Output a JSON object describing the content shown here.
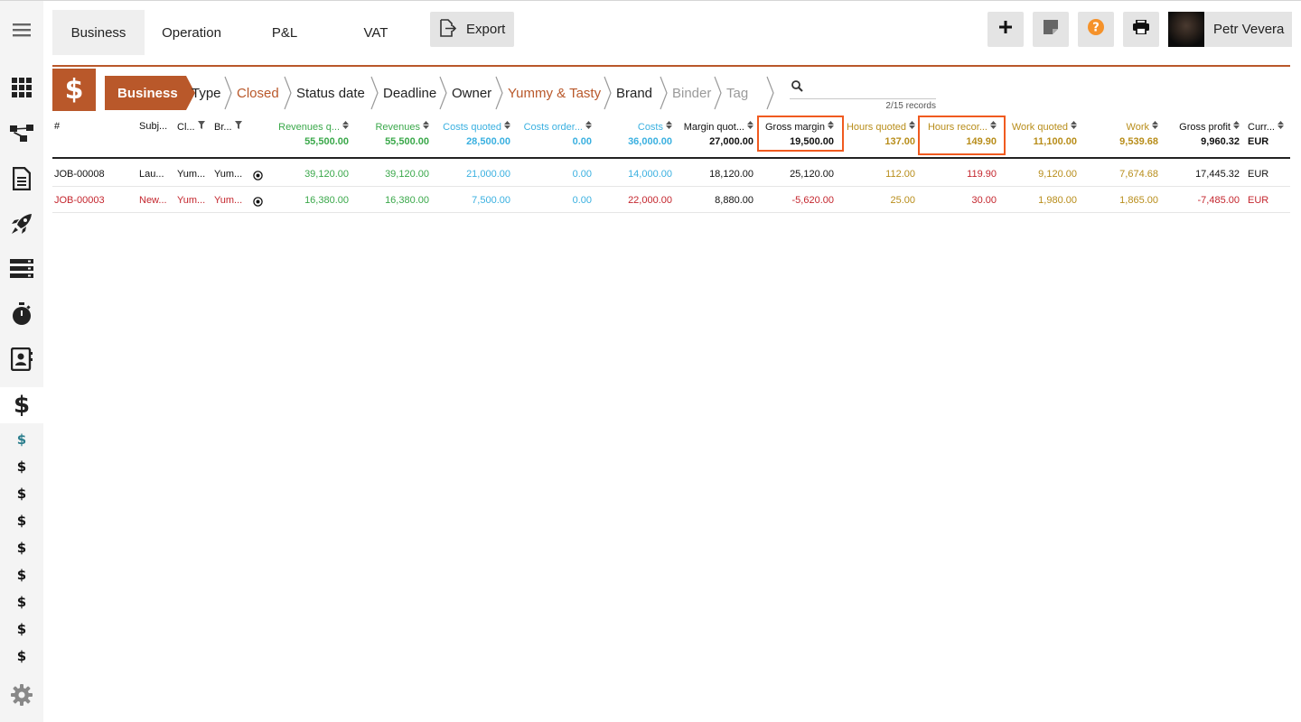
{
  "topbar": {
    "tabs": [
      "Business",
      "Operation",
      "P&L",
      "VAT"
    ],
    "active_tab": "Business",
    "export_label": "Export",
    "user_name": "Petr Vevera",
    "help_color": "#f5922a"
  },
  "breadcrumbs": [
    {
      "label": "Business",
      "state": "active"
    },
    {
      "label": "Type",
      "state": "normal"
    },
    {
      "label": "Closed",
      "state": "selected"
    },
    {
      "label": "Status date",
      "state": "normal"
    },
    {
      "label": "Deadline",
      "state": "normal"
    },
    {
      "label": "Owner",
      "state": "normal"
    },
    {
      "label": "Yummy & Tasty",
      "state": "selected"
    },
    {
      "label": "Brand",
      "state": "normal"
    },
    {
      "label": "Binder",
      "state": "disabled"
    },
    {
      "label": "Tag",
      "state": "disabled"
    }
  ],
  "search": {
    "placeholder": "",
    "records": "2/15 records"
  },
  "table": {
    "columns": [
      "#",
      "Subj...",
      "Cl...",
      "Br...",
      "Revenues q...",
      "Revenues",
      "Costs quoted",
      "Costs order...",
      "Costs",
      "Margin quot...",
      "Gross margin",
      "Hours quoted",
      "Hours recor...",
      "Work quoted",
      "Work",
      "Gross profit",
      "Curr..."
    ],
    "totals": {
      "revenues_quoted": "55,500.00",
      "revenues": "55,500.00",
      "costs_quoted": "28,500.00",
      "costs_ordered": "0.00",
      "costs": "36,000.00",
      "margin_quoted": "27,000.00",
      "gross_margin": "19,500.00",
      "hours_quoted": "137.00",
      "hours_recorded": "149.90",
      "work_quoted": "11,100.00",
      "work": "9,539.68",
      "gross_profit": "9,960.32",
      "currency": "EUR"
    },
    "rows": [
      {
        "id": "JOB-00008",
        "subject": "Lau...",
        "client": "Yum...",
        "brand": "Yum...",
        "revenues_quoted": "39,120.00",
        "revenues": "39,120.00",
        "costs_quoted": "21,000.00",
        "costs_ordered": "0.00",
        "costs": "14,000.00",
        "margin_quoted": "18,120.00",
        "gross_margin": "25,120.00",
        "hours_quoted": "112.00",
        "hours_recorded": "119.90",
        "work_quoted": "9,120.00",
        "work": "7,674.68",
        "gross_profit": "17,445.32",
        "currency": "EUR",
        "negative": false
      },
      {
        "id": "JOB-00003",
        "subject": "New...",
        "client": "Yum...",
        "brand": "Yum...",
        "revenues_quoted": "16,380.00",
        "revenues": "16,380.00",
        "costs_quoted": "7,500.00",
        "costs_ordered": "0.00",
        "costs": "22,000.00",
        "margin_quoted": "8,880.00",
        "gross_margin": "-5,620.00",
        "hours_quoted": "25.00",
        "hours_recorded": "30.00",
        "work_quoted": "1,980.00",
        "work": "1,865.00",
        "gross_profit": "-7,485.00",
        "currency": "EUR",
        "negative": true
      }
    ]
  },
  "sidebar": {
    "icons": [
      "menu-icon",
      "apps-grid-icon",
      "workflow-icon",
      "document-icon",
      "rocket-icon",
      "server-icon",
      "stopwatch-icon",
      "contacts-icon",
      "dollar-icon",
      "settings-icon"
    ],
    "sub_items": [
      "$",
      "$",
      "$",
      "$",
      "$",
      "$",
      "$",
      "$",
      "$"
    ],
    "section_symbol": "$"
  },
  "colors": {
    "accent": "#b9582a",
    "highlight": "#f05a1f",
    "revenues": "#3aa84a",
    "costs": "#3ab0e0",
    "hours": "#b88d1a",
    "negative": "#c4262e"
  }
}
